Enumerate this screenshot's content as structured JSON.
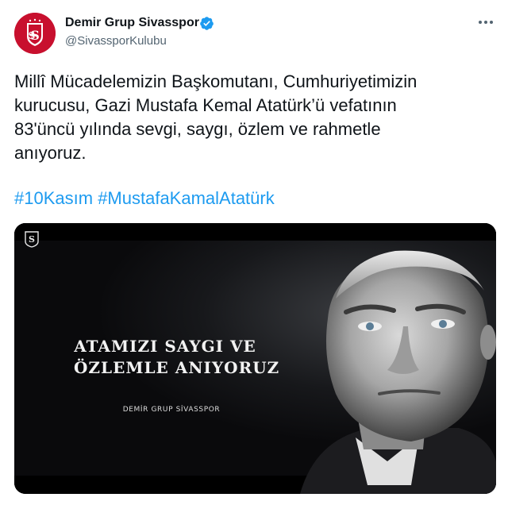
{
  "tweet": {
    "author": {
      "display_name": "Demir Grup Sivasspor",
      "handle": "@SivassporKulubu",
      "verified_icon": "verified-badge-icon",
      "avatar_icon": "sivasspor-logo"
    },
    "text_lines": [
      "Millî Mücadelemizin Başkomutanı, Cumhuriyetimizin",
      "kurucusu, Gazi Mustafa Kemal Atatürk’ü vefatının",
      "83'üncü yılında sevgi, saygı, özlem ve rahmetle",
      "anıyoruz."
    ],
    "hashtags": [
      "#10Kasım",
      "#MustafaKamalAtatürk"
    ],
    "media": {
      "title_lines": [
        "ATAMIZI SAYGI VE",
        "ÖZLEMLE ANIYORUZ"
      ],
      "brand": "DEMİR GRUP SİVASSPOR"
    }
  },
  "colors": {
    "link": "#1d9bf0",
    "club_red": "#c8102e",
    "text": "#0f1419",
    "muted": "#536471"
  }
}
